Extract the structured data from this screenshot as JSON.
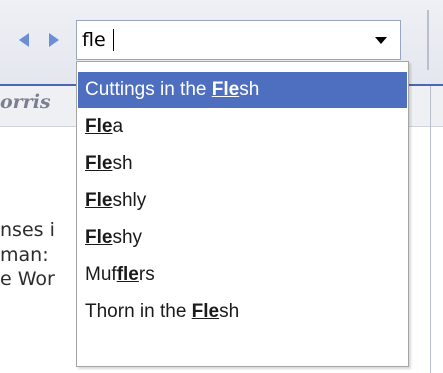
{
  "search": {
    "value": "fle",
    "placeholder": ""
  },
  "nav": {
    "back_icon": "triangle-left-icon",
    "forward_icon": "triangle-right-icon",
    "dropdown_icon": "triangle-down-icon"
  },
  "background": {
    "header_fragment": "orris",
    "lines": [
      "nses i",
      "man:",
      "e Wor"
    ]
  },
  "suggestions": [
    {
      "pre": "Cuttings in the ",
      "match": "Fle",
      "post": "sh",
      "selected": true
    },
    {
      "pre": "",
      "match": "Fle",
      "post": "a",
      "selected": false
    },
    {
      "pre": "",
      "match": "Fle",
      "post": "sh",
      "selected": false
    },
    {
      "pre": "",
      "match": "Fle",
      "post": "shly",
      "selected": false
    },
    {
      "pre": "",
      "match": "Fle",
      "post": "shy",
      "selected": false
    },
    {
      "pre": "Muf",
      "match": "fle",
      "post": "rs",
      "selected": false
    },
    {
      "pre": "Thorn in the ",
      "match": "Fle",
      "post": "sh",
      "selected": false
    }
  ],
  "colors": {
    "accent": "#4e6fbf",
    "nav_arrow": "#6b8ed6"
  }
}
